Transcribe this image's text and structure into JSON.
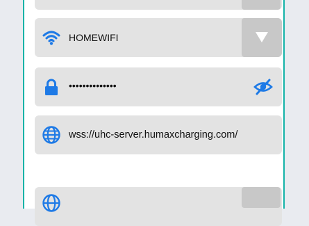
{
  "wifi": {
    "ssid": "HOMEWIFI",
    "icon": "wifi-icon",
    "dropdown_icon": "triangle-down-icon"
  },
  "password": {
    "value": "••••••••••••••",
    "icon": "lock-icon",
    "toggle_icon": "eye-slash-icon"
  },
  "server": {
    "url": "wss://uhc-server.humaxcharging.com/",
    "icon": "globe-icon"
  },
  "colors": {
    "accent": "#1e7ae6",
    "frame": "#12b3a8",
    "field_bg": "#e3e3e3",
    "button_bg": "#c8c8c8"
  }
}
